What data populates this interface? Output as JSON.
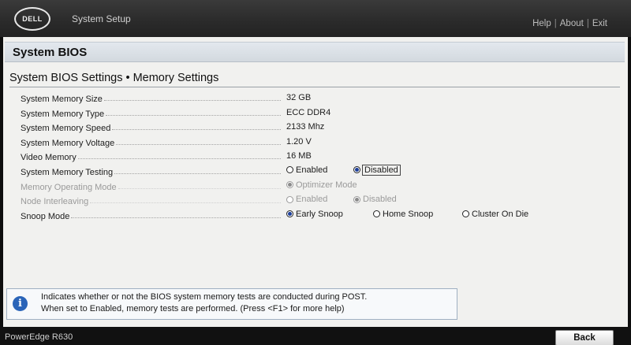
{
  "header": {
    "logo_text": "DELL",
    "app_title": "System Setup",
    "links": [
      "Help",
      "About",
      "Exit"
    ],
    "link_separator": "|"
  },
  "page_title": "System BIOS",
  "section_title": "System BIOS Settings • Memory Settings",
  "settings": {
    "memory_size": {
      "label": "System Memory Size",
      "value": "32 GB"
    },
    "memory_type": {
      "label": "System Memory Type",
      "value": "ECC DDR4"
    },
    "memory_speed": {
      "label": "System Memory Speed",
      "value": "2133 Mhz"
    },
    "memory_voltage": {
      "label": "System Memory Voltage",
      "value": "1.20 V"
    },
    "video_memory": {
      "label": "Video Memory",
      "value": "16 MB"
    },
    "memory_testing": {
      "label": "System Memory Testing",
      "options": [
        "Enabled",
        "Disabled"
      ],
      "selected": "Disabled",
      "enabled": true
    },
    "operating_mode": {
      "label": "Memory Operating Mode",
      "options": [
        "Optimizer Mode"
      ],
      "selected": "Optimizer Mode",
      "enabled": false
    },
    "node_interleaving": {
      "label": "Node Interleaving",
      "options": [
        "Enabled",
        "Disabled"
      ],
      "selected": "Disabled",
      "enabled": false
    },
    "snoop_mode": {
      "label": "Snoop Mode",
      "options": [
        "Early Snoop",
        "Home Snoop",
        "Cluster On Die"
      ],
      "selected": "Early Snoop",
      "enabled": true
    }
  },
  "help": {
    "icon": "info-icon",
    "line1": "Indicates whether or not the BIOS system memory tests are conducted during POST.",
    "line2": "When set to Enabled, memory tests are performed. (Press <F1> for more help)"
  },
  "footer": {
    "model": "PowerEdge R630",
    "back_label": "Back"
  },
  "colors": {
    "header_bg": "#2c2c2c",
    "screen_bg": "#f1f1ef",
    "title_bar_bg": "#dbe0e6",
    "radio_selected": "#1d3f9a",
    "info_icon": "#2a64b8",
    "disabled_text": "#9a9a9a"
  }
}
